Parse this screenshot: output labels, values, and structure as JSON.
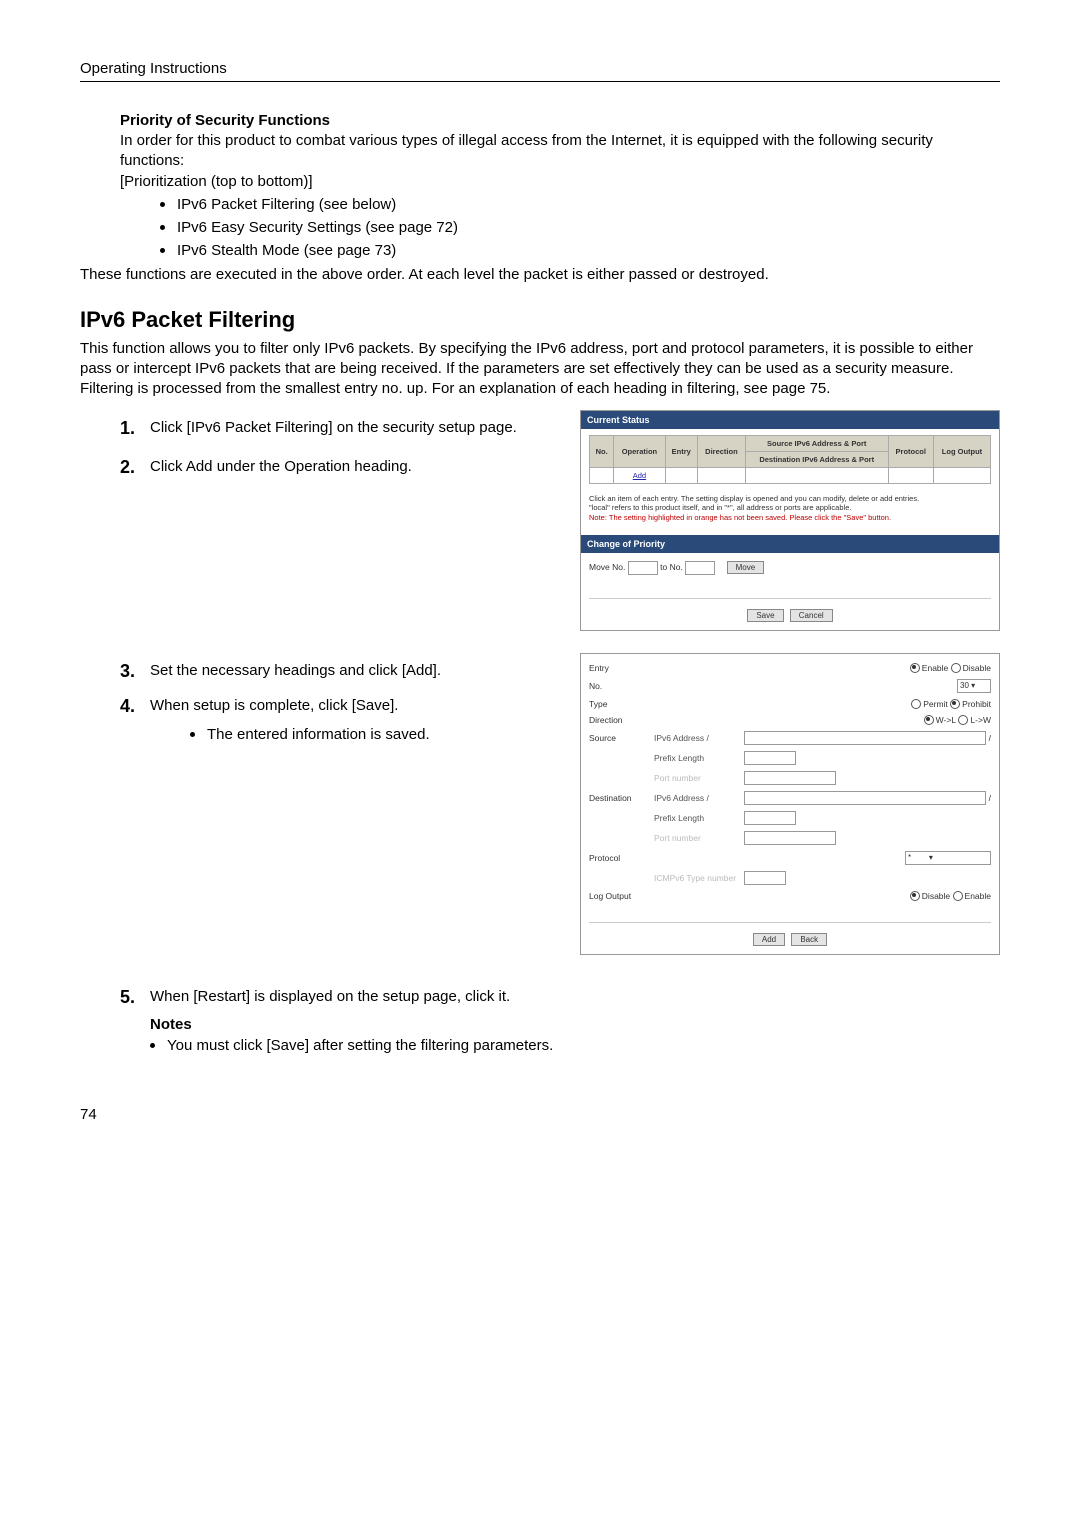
{
  "header": {
    "running_head": "Operating Instructions"
  },
  "priority": {
    "heading": "Priority of Security Functions",
    "para1": "In order for this product to combat various types of illegal access from the Internet, it is equipped with the following security functions:",
    "para2": "[Prioritization (top to bottom)]",
    "bullets": [
      "IPv6 Packet Filtering (see below)",
      "IPv6 Easy Security Settings (see page 72)",
      "IPv6 Stealth Mode (see page 73)"
    ],
    "para3": "These functions are executed in the above order. At each level the packet is either passed or destroyed."
  },
  "filtering": {
    "title": "IPv6 Packet Filtering",
    "intro": "This function allows you to filter only IPv6 packets. By specifying the IPv6 address, port and protocol parameters, it is possible to either pass or intercept IPv6 packets that are being received. If the parameters are set effectively they can be used as a security measure. Filtering is processed from the smallest entry no. up. For an explanation of each heading in filtering, see page 75.",
    "steps": {
      "s1": "Click [IPv6 Packet Filtering] on the security setup page.",
      "s2": "Click Add under the Operation heading.",
      "s3": "Set the necessary headings and click [Add].",
      "s4": "When setup is complete, click [Save].",
      "s4_bullet": "The entered information is saved.",
      "s5": "When [Restart] is displayed on the setup page, click it."
    },
    "notes_heading": "Notes",
    "notes_bullet": "You must click [Save] after setting the filtering parameters."
  },
  "shot1": {
    "bar_current": "Current Status",
    "th_no": "No.",
    "th_operation": "Operation",
    "th_entry": "Entry",
    "th_direction": "Direction",
    "th_src": "Source IPv6 Address & Port",
    "th_dst": "Destination IPv6 Address & Port",
    "th_protocol": "Protocol",
    "th_log": "Log Output",
    "add_link": "Add",
    "note_line1": "Click an item of each entry. The setting display is opened and you can modify, delete or add entries.",
    "note_line2": "\"local\" refers to this product itself, and in \"*\", all address or ports are applicable.",
    "note_red": "Note: The setting highlighted in orange has not been saved. Please click the \"Save\" button.",
    "bar_change": "Change of Priority",
    "move_no": "Move No.",
    "to_no": "to No.",
    "btn_move": "Move",
    "btn_save": "Save",
    "btn_cancel": "Cancel"
  },
  "shot2": {
    "entry": "Entry",
    "enable": "Enable",
    "disable": "Disable",
    "no": "No.",
    "no_val": "30",
    "type": "Type",
    "permit": "Permit",
    "prohibit": "Prohibit",
    "direction": "Direction",
    "wl": "W->L",
    "lw": "L->W",
    "source": "Source",
    "ipv6addr": "IPv6 Address /",
    "prefixlen": "Prefix Length",
    "portnum": "Port number",
    "destination": "Destination",
    "protocol": "Protocol",
    "protocol_val": "*",
    "icmp": "ICMPv6 Type number",
    "logoutput": "Log Output",
    "btn_add": "Add",
    "btn_back": "Back"
  },
  "footer": {
    "page": "74"
  }
}
